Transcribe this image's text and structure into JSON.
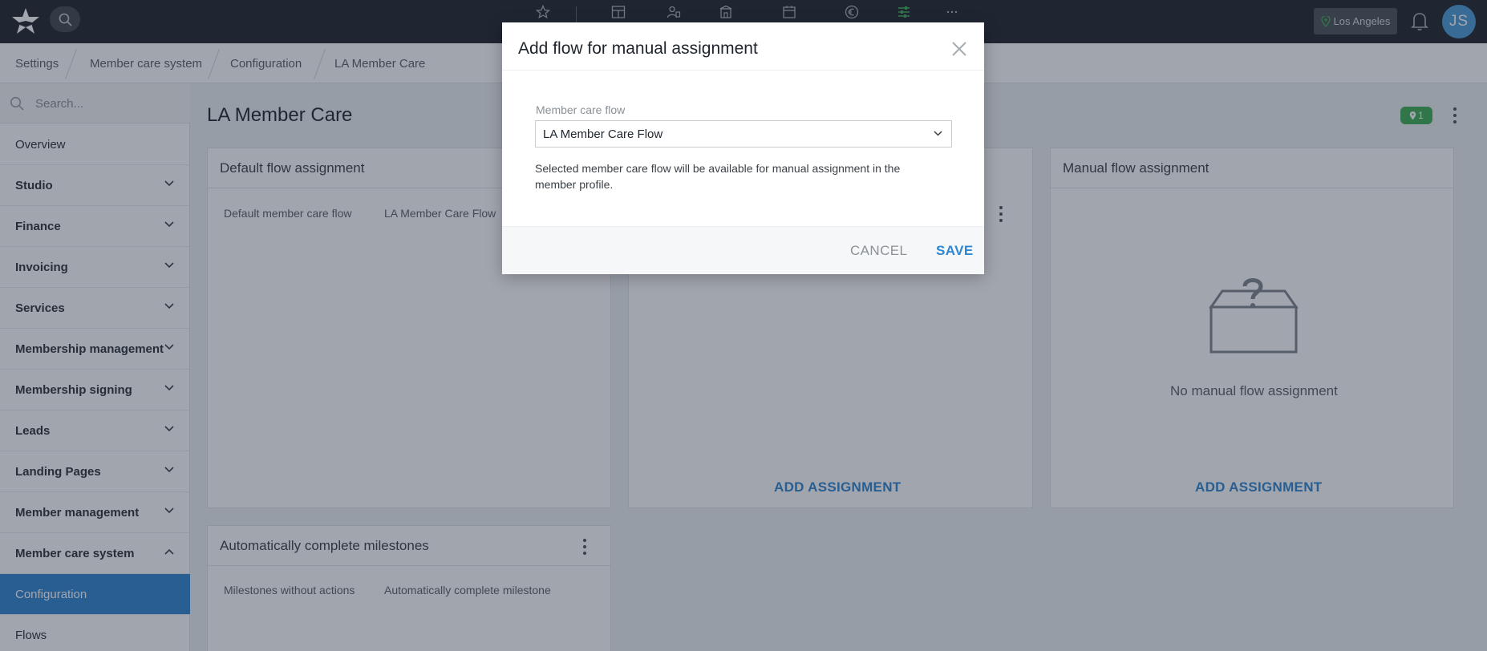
{
  "topbar": {
    "location_label": "Los Angeles",
    "avatar_initials": "JS",
    "icons": [
      "star-icon",
      "dashboard-icon",
      "user-settings-icon",
      "building-icon",
      "calendar-icon",
      "euro-icon",
      "sliders-icon",
      "more-icon"
    ],
    "accent_color": "#3fae52"
  },
  "breadcrumb": [
    "Settings",
    "Member care system",
    "Configuration",
    "LA Member Care"
  ],
  "sidebar": {
    "search_placeholder": "Search...",
    "items": [
      {
        "label": "Overview"
      },
      {
        "label": "Studio"
      },
      {
        "label": "Finance"
      },
      {
        "label": "Invoicing"
      },
      {
        "label": "Services"
      },
      {
        "label": "Membership management"
      },
      {
        "label": "Membership signing"
      },
      {
        "label": "Leads"
      },
      {
        "label": "Landing Pages"
      },
      {
        "label": "Member management"
      },
      {
        "label": "Member care system"
      },
      {
        "label": "Configuration"
      },
      {
        "label": "Flows"
      }
    ]
  },
  "main": {
    "title": "LA Member Care",
    "badge_count": "1",
    "cards": {
      "default": {
        "title": "Default flow assignment",
        "label": "Default member care flow",
        "value": "LA Member Care Flow"
      },
      "middle": {
        "action": "ADD ASSIGNMENT"
      },
      "manual": {
        "title": "Manual flow assignment",
        "empty": "No manual flow assignment",
        "action": "ADD ASSIGNMENT"
      },
      "milestones": {
        "title": "Automatically complete milestones",
        "label": "Milestones without actions",
        "value": "Automatically complete milestone"
      }
    }
  },
  "dialog": {
    "title": "Add flow for manual assignment",
    "field_label": "Member care flow",
    "selected": "LA Member Care Flow",
    "help": "Selected member care flow will be available for manual assignment in the member profile.",
    "cancel": "CANCEL",
    "save": "SAVE"
  }
}
